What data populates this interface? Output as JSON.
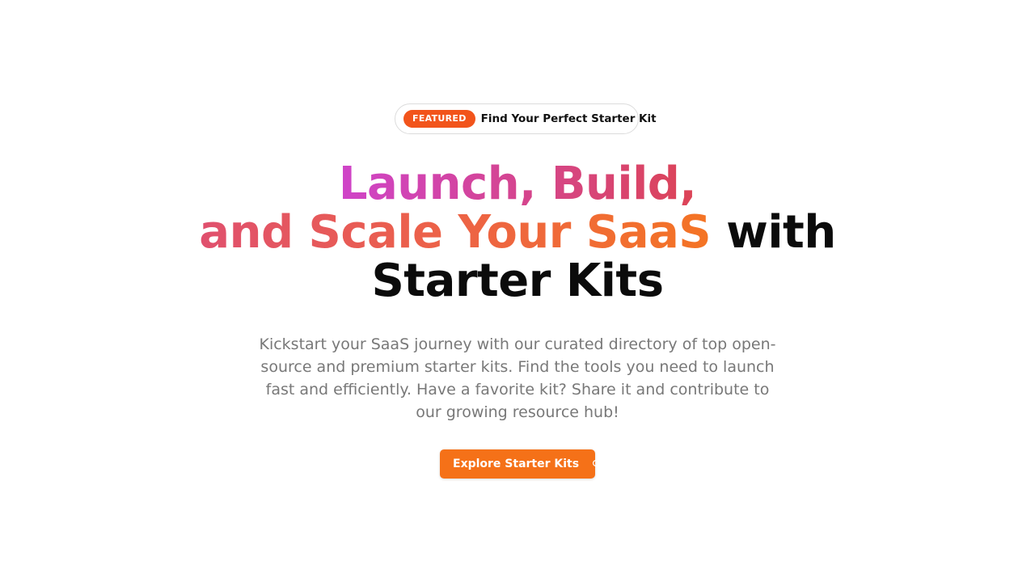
{
  "badge": {
    "tag": "FEATURED",
    "text": "Find Your Perfect Starter Kit"
  },
  "headline": {
    "part1": "Launch, Build,",
    "part2": "and Scale Your SaaS",
    "part3": "with",
    "part4": "Starter Kits"
  },
  "subtitle": "Kickstart your SaaS journey with our curated directory of top open-source and premium starter kits. Find the tools you need to launch fast and efficiently. Have a favorite kit? Share it and contribute to our growing resource hub!",
  "cta": {
    "label": "Explore Starter Kits",
    "icon": "search-icon"
  },
  "colors": {
    "badge_tag": "#f2541b",
    "cta": "#f57118",
    "gradient_start": "#cf44c9",
    "gradient_end": "#f47424"
  }
}
